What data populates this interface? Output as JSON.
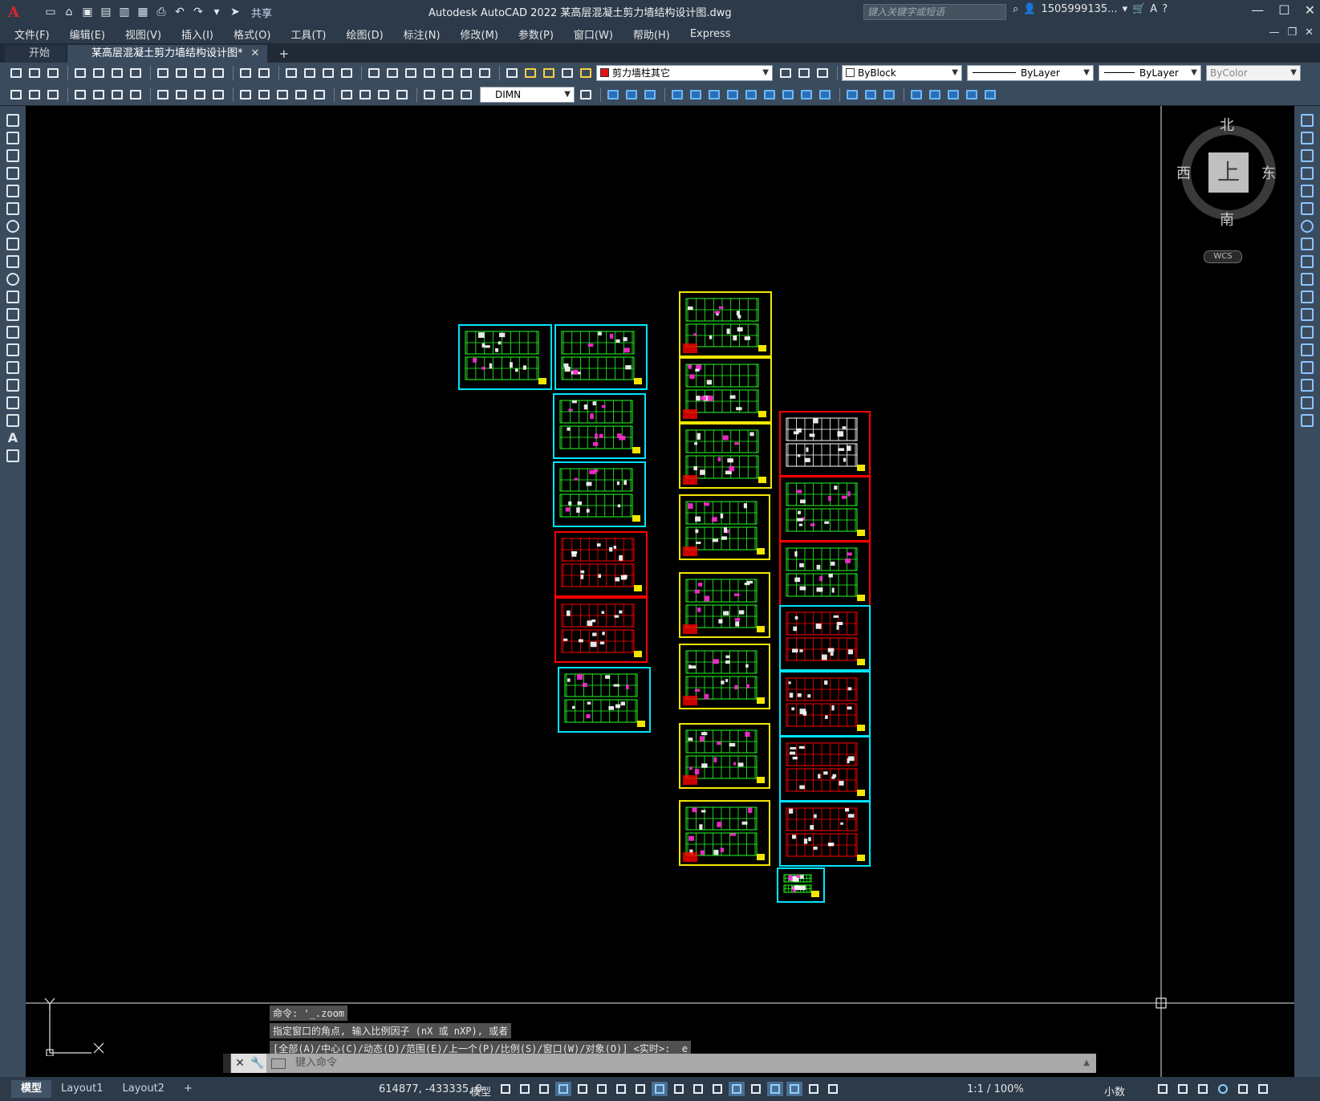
{
  "titlebar": {
    "logo": "A",
    "share": "共享",
    "title": "Autodesk AutoCAD 2022    某高层混凝土剪力墙结构设计图.dwg",
    "search_placeholder": "键入关键字或短语",
    "user": "1505999135...",
    "help": "?"
  },
  "menu": [
    "文件(F)",
    "编辑(E)",
    "视图(V)",
    "插入(I)",
    "格式(O)",
    "工具(T)",
    "绘图(D)",
    "标注(N)",
    "修改(M)",
    "参数(P)",
    "窗口(W)",
    "帮助(H)",
    "Express"
  ],
  "tabs": [
    {
      "label": "开始",
      "active": false
    },
    {
      "label": "某高层混凝土剪力墙结构设计图*",
      "active": true
    }
  ],
  "properties": {
    "layer": "剪力墙柱其它",
    "layer_color": "#e31414",
    "color": "ByBlock",
    "linetype": "ByLayer",
    "lineweight": "ByLayer",
    "plotstyle": "ByColor",
    "dimstyle": "DIMN"
  },
  "viewcube": {
    "north": "北",
    "south": "南",
    "east": "东",
    "west": "西",
    "face": "上",
    "wcs": "WCS"
  },
  "command_history": [
    "命令: '_.zoom",
    "指定窗口的角点, 输入比例因子 (nX 或 nXP), 或者",
    "[全部(A)/中心(C)/动态(D)/范围(E)/上一个(P)/比例(S)/窗口(W)/对象(O)] <实时>: _e"
  ],
  "command_input_placeholder": "键入命令",
  "statusbar": {
    "layout_tabs": [
      {
        "label": "模型",
        "active": true
      },
      {
        "label": "Layout1",
        "active": false
      },
      {
        "label": "Layout2",
        "active": false
      }
    ],
    "add_tab": "+",
    "coordinates": "614877, -433335, 0",
    "space": "模型",
    "scale": "1:1 / 100%",
    "units": "小数"
  },
  "colors": {
    "chrome_dark": "#2c3a4a",
    "toolbar": "#3b4b5e",
    "canvas": "#000000",
    "frame_cyan": "#00e5ff",
    "frame_yellow": "#f2e600",
    "frame_red": "#ff0000",
    "drawing_green": "#22ff22"
  }
}
